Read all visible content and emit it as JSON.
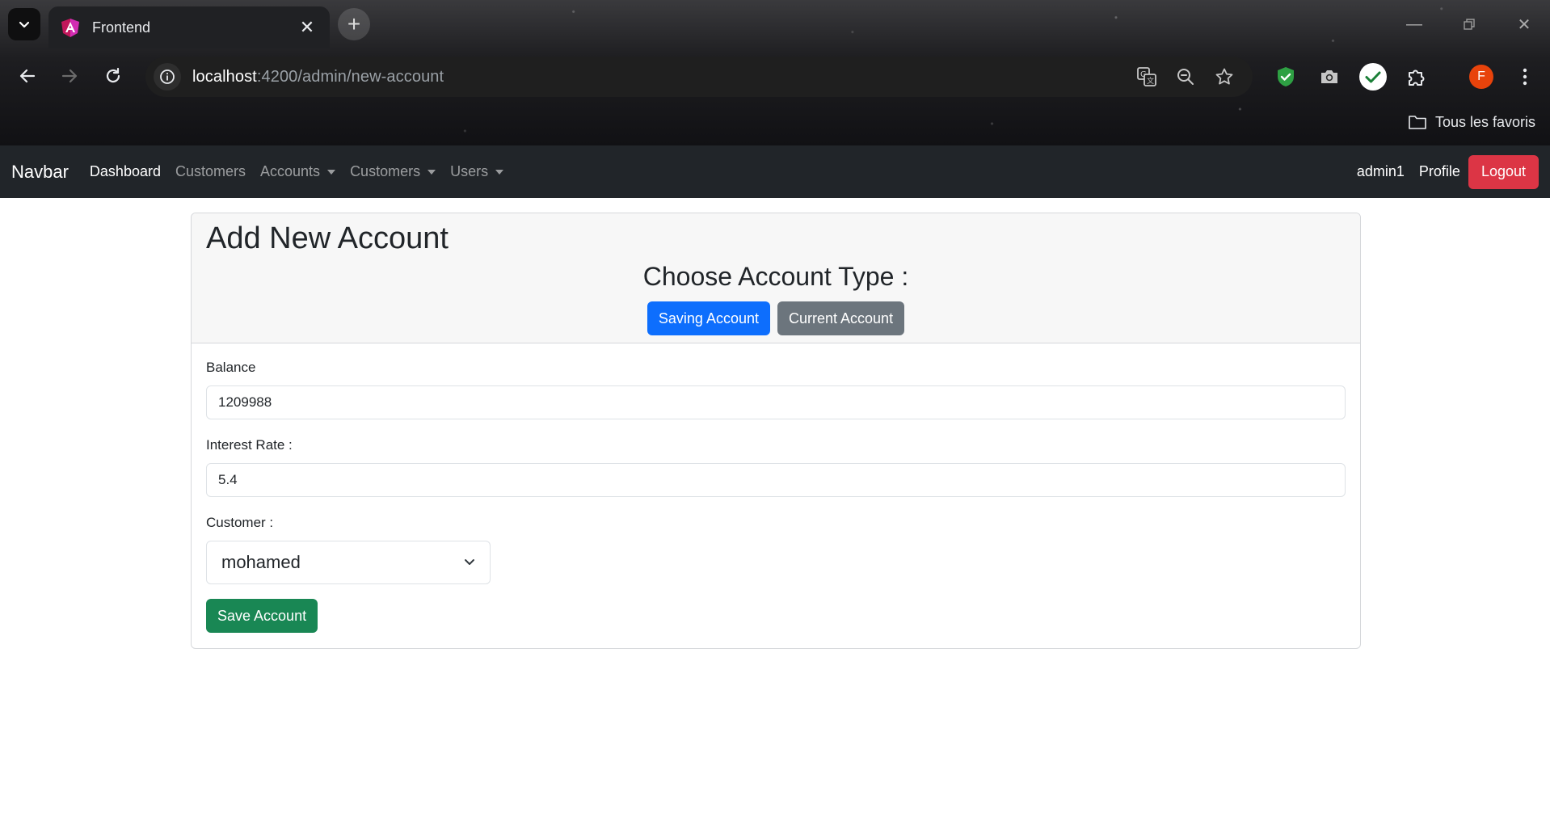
{
  "browser": {
    "tab_title": "Frontend",
    "url_host": "localhost",
    "url_path": ":4200/admin/new-account",
    "bookmarks_label": "Tous les favoris",
    "profile_initial": "F",
    "colors": {
      "accent_profile": "#e8430b",
      "shield_ext": "#2ea043"
    }
  },
  "navbar": {
    "brand": "Navbar",
    "links": {
      "dashboard": "Dashboard",
      "customers": "Customers",
      "accounts": "Accounts",
      "customers_dropdown": "Customers",
      "users": "Users"
    },
    "username": "admin1",
    "profile": "Profile",
    "logout": "Logout"
  },
  "card": {
    "title": "Add New Account",
    "choose_label": "Choose Account Type :",
    "saving_button": "Saving Account",
    "current_button": "Current Account"
  },
  "form": {
    "balance_label": "Balance",
    "balance_value": "1209988",
    "interest_label": "Interest Rate :",
    "interest_value": "5.4",
    "customer_label": "Customer :",
    "customer_selected": "mohamed",
    "save_button": "Save Account"
  },
  "colors": {
    "navbar_bg": "#212529",
    "primary": "#0d6efd",
    "secondary": "#6c757d",
    "success": "#198754",
    "danger": "#dc3545"
  }
}
